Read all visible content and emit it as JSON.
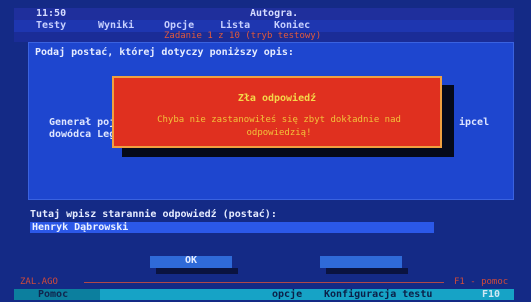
{
  "title_bar": {
    "time": "11:50",
    "app_name": "Autogra."
  },
  "menu": {
    "items": [
      "Testy",
      "Wyniki",
      "Opcje",
      "Lista",
      "Koniec"
    ]
  },
  "info_bar": {
    "text": "Zadanie 1 z 10 (tryb testowy)"
  },
  "question": {
    "label": "Podaj postać, której dotyczy poniższy opis:",
    "lines": [
      "Generał poj",
      "dowódca Leg"
    ],
    "right_fragment": "ipcel"
  },
  "popup": {
    "title": "Zła odpowiedź",
    "message": "Chyba nie zastanowiłeś się zbyt dokładnie nad odpowiedzią!"
  },
  "answer": {
    "label": "Tutaj wpisz starannie odpowiedź (postać):",
    "value": "Henryk Dąbrowski"
  },
  "buttons": {
    "ok": "OK",
    "second": ""
  },
  "bottom_line": {
    "left": "ZAL.AGO",
    "right": "F1 - pomoc"
  },
  "status_bar": {
    "left": "Pomoc",
    "mid1": "opcje",
    "mid2": "Konfiguracja testu",
    "right": "F10"
  },
  "colors": {
    "background": "#142a86",
    "panel": "#1e46cf",
    "popup": "#e0301f",
    "popup_text": "#f3d232",
    "status_bar": "#16a3c6"
  }
}
